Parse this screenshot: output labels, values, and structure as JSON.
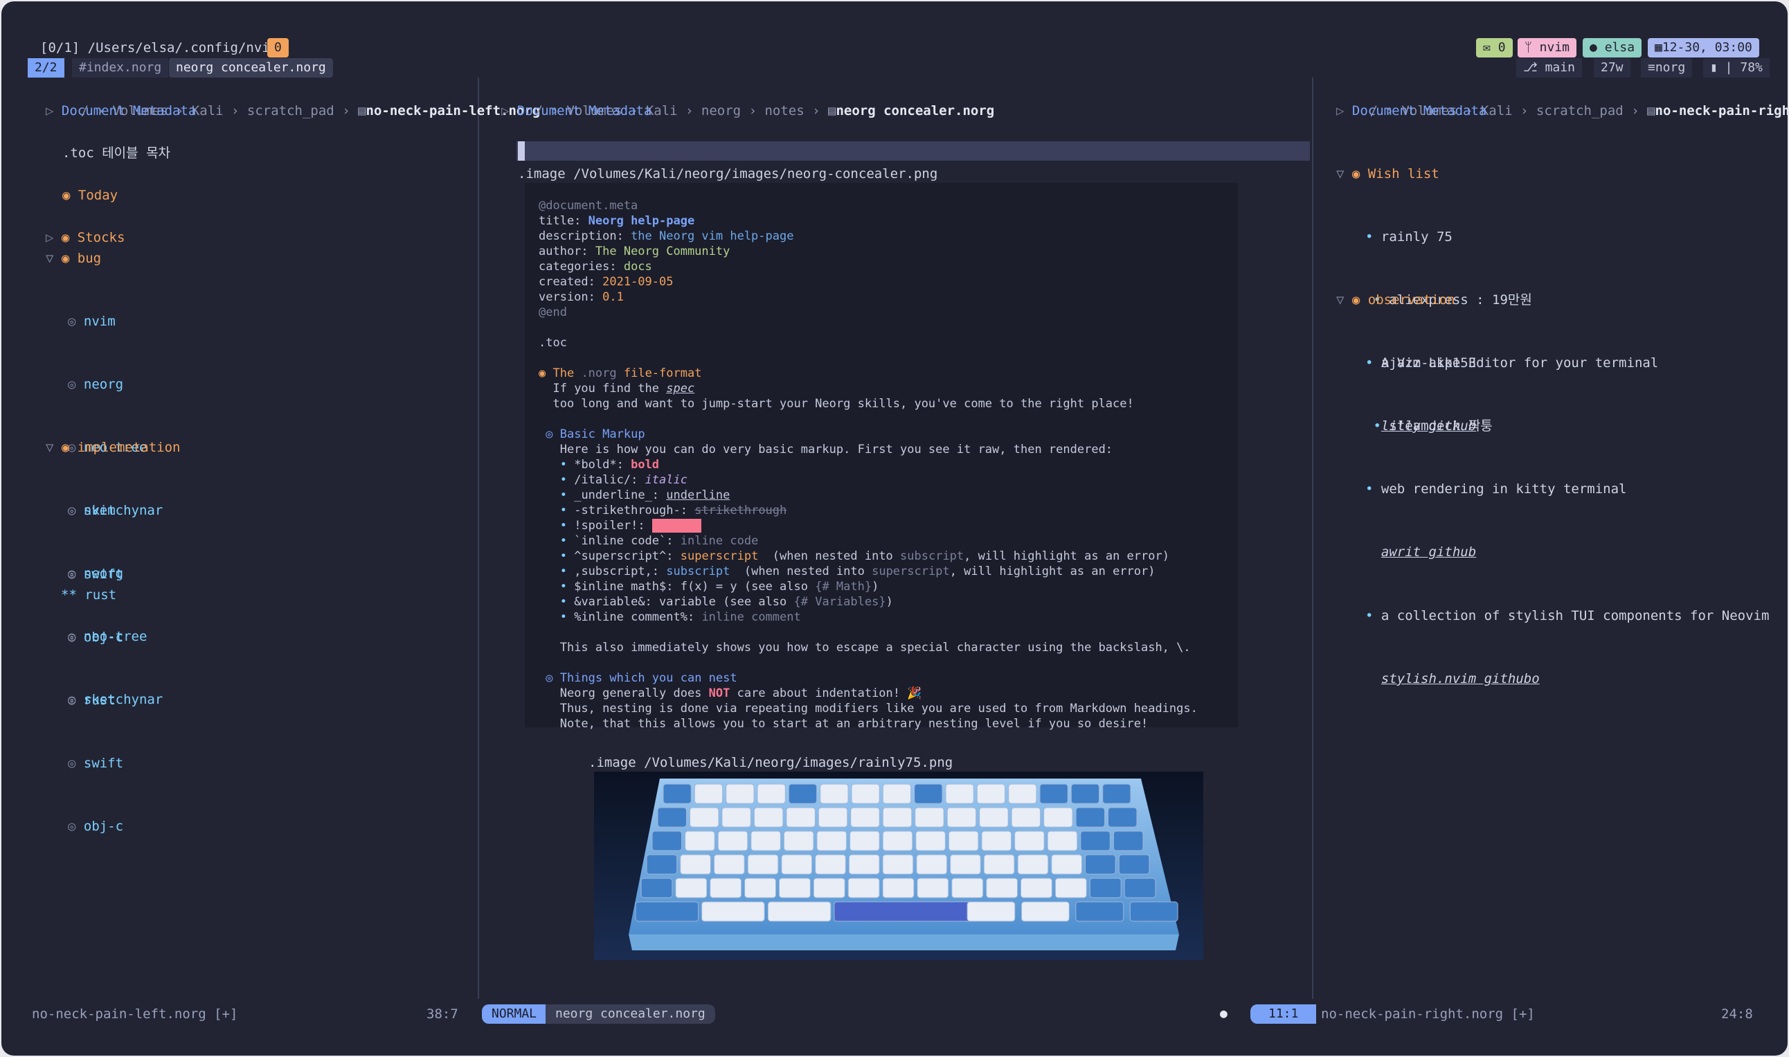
{
  "tmux": {
    "session": "[0/1] /Users/elsa/.config/nvim",
    "window_count": "0",
    "mail_icon": "mail-icon",
    "mail_count": "0",
    "app": "nvim",
    "user": "elsa",
    "datetime": "12-30, 03:00"
  },
  "tabs": {
    "position": "2/2",
    "items": [
      "#index.norg",
      "neorg concealer.norg"
    ],
    "git_branch": "main",
    "words": "27w",
    "filetype": "norg",
    "battery": "78%"
  },
  "left": {
    "breadcrumb": [
      "/",
      "Volumes",
      "Kali",
      "scratch_pad"
    ],
    "file": "no-neck-pain-left.norg",
    "metadata": "Document Metadata",
    "toc": ".toc 테이블 목차",
    "today": "Today",
    "stocks": "Stocks",
    "bug": "bug",
    "bug_items": [
      "nvim",
      "neorg",
      "neo-tree",
      "sketchynar",
      "swift",
      "obj-c",
      "rust"
    ],
    "impl": "implemetation",
    "impl_items": [
      "nvim",
      "neorg",
      "neo-tree",
      "sketchynar",
      "swift",
      "obj-c"
    ],
    "impl_last": "** rust",
    "status_file": "no-neck-pain-left.norg [+]",
    "status_pos": "38:7"
  },
  "center": {
    "breadcrumb": [
      "/",
      "Volumes",
      "Kali",
      "neorg",
      "notes"
    ],
    "file": "neorg concealer.norg",
    "metadata": "Document Metadata",
    "image1": ".image /Volumes/Kali/neorg/images/neorg-concealer.png",
    "meta_tag": "@document.meta",
    "title_key": "title: ",
    "title_val": "Neorg help-page",
    "desc_key": "description: ",
    "desc_val": "the Neorg vim help-page",
    "author_key": "author: ",
    "author_val": "The Neorg Community",
    "cat_key": "categories: ",
    "cat_val": "docs",
    "created_key": "created: ",
    "created_val": "2021-09-05",
    "version_key": "version: ",
    "version_val": "0.1",
    "end": "@end",
    "toc": ".toc",
    "h1_a": "The ",
    "h1_b": ".norg",
    "h1_c": " file-format",
    "p1a": "If you find the ",
    "p1b": "spec",
    "p2": "too long and want to jump-start your Neorg skills, you've come to the right place!",
    "h2": "Basic Markup",
    "p3": "Here is how you can do very basic markup. First you see it raw, then rendered:",
    "m_bold_raw": "*bold*: ",
    "m_bold": "bold",
    "m_italic_raw": "/italic/: ",
    "m_italic": "italic",
    "m_under_raw": "_underline_: ",
    "m_under": "underline",
    "m_strike_raw": "-strikethrough-: ",
    "m_strike": "strikethrough",
    "m_spoiler_raw": "!spoiler!: ",
    "m_spoiler": "•••••••",
    "m_code_raw": "`inline code`: ",
    "m_code": "inline code",
    "m_sup_raw": "^superscript^: ",
    "m_sup": "superscript",
    "m_sup_note_a": "  (when nested into ",
    "m_sup_note_b": "subscript",
    "m_sup_note_c": ", will highlight as an error)",
    "m_sub_raw": ",subscript,: ",
    "m_sub": "subscript",
    "m_sub_note_a": "  (when nested into ",
    "m_sub_note_b": "superscript",
    "m_sub_note_c": ", will highlight as an error)",
    "m_math_raw": "$inline math$: ",
    "m_math": "f(x) = y",
    "m_math_see": " (see also ",
    "m_math_link": "{# Math}",
    "m_close": ")",
    "m_var_raw": "&variable&: ",
    "m_var": "variable",
    "m_var_see": " (see also ",
    "m_var_link": "{# Variables}",
    "m_com_raw": "%inline comment%: ",
    "m_com": "inline comment",
    "p4": "This also immediately shows you how to escape a special character using the backslash, \\.",
    "h3": "Things which you can nest",
    "p5a": "Neorg generally does ",
    "p5b": "NOT",
    "p5c": " care about indentation! 🎉",
    "p6": "Thus, nesting is done via repeating modifiers like you are used to from Markdown headings.",
    "p7": "Note, that this allows you to start at an arbitrary nesting level if you so desire!",
    "image2": ".image /Volumes/Kali/neorg/images/rainly75.png",
    "mode": "NORMAL",
    "status_file": "neorg concealer.norg",
    "status_pos": "11:1"
  },
  "right": {
    "breadcrumb": [
      "/",
      "Volumes",
      "Kali",
      "scratch_pad"
    ],
    "file": "no-neck-pain-right.norg",
    "metadata": "Document Metadata",
    "wish": "Wish list",
    "wish_items": [
      "rainly 75",
      "aliexpress : 19만원",
      "ajazz akp153",
      "steamdeck 짝퉁"
    ],
    "obs": "observation",
    "obs_items": [
      "A Vim-Like Editor for your terminal",
      "web rendering in kitty terminal",
      "a collection of stylish TUI components for Neovim"
    ],
    "obs_links": [
      "lilly github",
      "awrit github",
      "stylish.nvim githubo"
    ],
    "status_file": "no-neck-pain-right.norg [+]",
    "status_pos": "24:8"
  },
  "colors": {
    "bg": "#222433",
    "accent": "#7aa2f7",
    "heading": "#f2a25a",
    "mode_bg": "#7aa2f7"
  }
}
